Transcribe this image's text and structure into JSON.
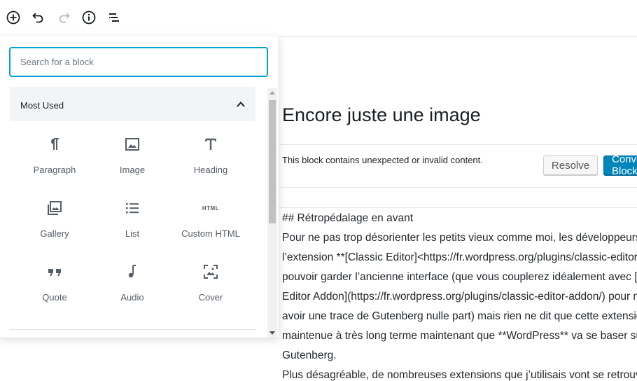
{
  "toolbar": {
    "buttons": [
      {
        "name": "add-block",
        "icon": "plus-circle-icon"
      },
      {
        "name": "undo",
        "icon": "undo-icon"
      },
      {
        "name": "redo",
        "icon": "redo-icon"
      },
      {
        "name": "info",
        "icon": "info-icon"
      },
      {
        "name": "outline",
        "icon": "list-outline-icon"
      }
    ]
  },
  "inserter": {
    "search_placeholder": "Search for a block",
    "section_title": "Most Used",
    "blocks": [
      {
        "label": "Paragraph",
        "icon": "pilcrow-icon"
      },
      {
        "label": "Image",
        "icon": "image-icon"
      },
      {
        "label": "Heading",
        "icon": "heading-icon"
      },
      {
        "label": "Gallery",
        "icon": "gallery-icon"
      },
      {
        "label": "List",
        "icon": "list-icon"
      },
      {
        "label": "Custom HTML",
        "icon": "html-icon"
      },
      {
        "label": "Quote",
        "icon": "quote-icon"
      },
      {
        "label": "Audio",
        "icon": "audio-icon"
      },
      {
        "label": "Cover",
        "icon": "cover-icon"
      }
    ],
    "html_icon_text": "HTML"
  },
  "editor": {
    "title": "Encore juste une image",
    "warning_text": "This block contains unexpected or invalid content.",
    "resolve_label": "Resolve",
    "convert_label": "Convert to Blocks",
    "content_lines": [
      "## Rétropédalage en avant",
      "Pour ne pas trop désorienter les petits vieux comme moi, les développeurs ont sorti",
      "l’extension **[Classic Editor]<https://fr.wordpress.org/plugins/classic-editor/>** pour",
      "pouvoir garder l’ancienne interface (que vous couplerez idéalement avec [Classic",
      "Editor Addon](https://fr.wordpress.org/plugins/classic-editor-addon/) pour ne plus",
      "avoir une trace de Gutenberg nulle part) mais rien ne dit que cette extension sera",
      "maintenue à très long terme maintenant que **WordPress** va se baser sur",
      "Gutenberg.",
      "Plus désagréable, de nombreuses extensions que j’utilisais vont se retrouver"
    ]
  },
  "colors": {
    "accent": "#00a0d2",
    "primary_button": "#0085ba",
    "panel_header": "#f3f4f5",
    "icon": "#555d66"
  }
}
